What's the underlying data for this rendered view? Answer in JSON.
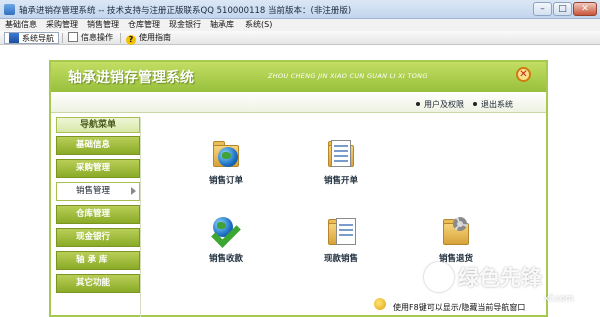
{
  "window": {
    "title": "轴承进销存管理系统 -- 技术支持与注册正版联系QQ 510000118    当前版本：(非注册版)",
    "minimize": "–",
    "maximize": "□",
    "close": "✕"
  },
  "menubar": [
    "基础信息",
    "采购管理",
    "销售管理",
    "仓库管理",
    "现金银行",
    "轴承库",
    "系统(S)"
  ],
  "toolbar": [
    {
      "label": "系统导航",
      "icon": "navigation-icon"
    },
    {
      "label": "信息操作",
      "icon": "document-icon"
    },
    {
      "label": "使用指南",
      "icon": "help-icon"
    }
  ],
  "header": {
    "title": "轴承进销存管理系统",
    "subtitle": "ZHOU CHENG JIN XIAO CUN GUAN LI XI TONG",
    "close": "✕"
  },
  "sublinks": [
    "用户及权限",
    "退出系统"
  ],
  "sidebar": {
    "heading": "导航菜单",
    "items": [
      "基础信息",
      "采购管理",
      "销售管理",
      "仓库管理",
      "现金银行",
      "轴 承 库",
      "其它功能"
    ],
    "active": "销售管理"
  },
  "functions": [
    {
      "label": "销售订单",
      "icon": "globe-folder-icon"
    },
    {
      "label": "销售开单",
      "icon": "document-list-icon"
    },
    {
      "label": "销售收款",
      "icon": "globe-check-icon"
    },
    {
      "label": "现款销售",
      "icon": "document-folder-icon"
    },
    {
      "label": "销售退货",
      "icon": "gear-folder-icon"
    }
  ],
  "footer": {
    "hint": "使用F8键可以显示/隐藏当前导航窗口"
  },
  "watermark": {
    "text": "绿色先锋",
    "sub": "xf.com"
  },
  "colors": {
    "accent": "#98c03c",
    "nav": "#8aab27",
    "close": "#d07a12"
  }
}
